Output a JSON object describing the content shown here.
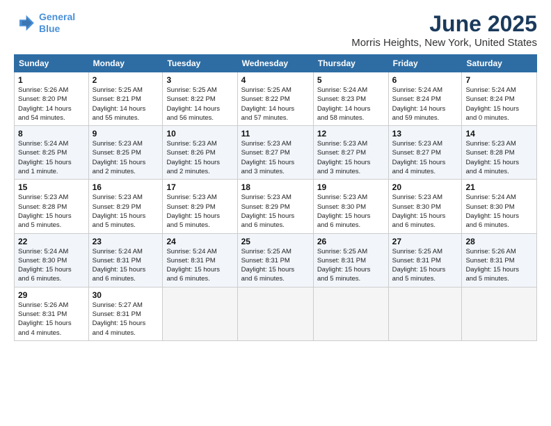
{
  "header": {
    "logo_line1": "General",
    "logo_line2": "Blue",
    "month": "June 2025",
    "location": "Morris Heights, New York, United States"
  },
  "weekdays": [
    "Sunday",
    "Monday",
    "Tuesday",
    "Wednesday",
    "Thursday",
    "Friday",
    "Saturday"
  ],
  "weeks": [
    [
      {
        "day": "1",
        "info": "Sunrise: 5:26 AM\nSunset: 8:20 PM\nDaylight: 14 hours\nand 54 minutes."
      },
      {
        "day": "2",
        "info": "Sunrise: 5:25 AM\nSunset: 8:21 PM\nDaylight: 14 hours\nand 55 minutes."
      },
      {
        "day": "3",
        "info": "Sunrise: 5:25 AM\nSunset: 8:22 PM\nDaylight: 14 hours\nand 56 minutes."
      },
      {
        "day": "4",
        "info": "Sunrise: 5:25 AM\nSunset: 8:22 PM\nDaylight: 14 hours\nand 57 minutes."
      },
      {
        "day": "5",
        "info": "Sunrise: 5:24 AM\nSunset: 8:23 PM\nDaylight: 14 hours\nand 58 minutes."
      },
      {
        "day": "6",
        "info": "Sunrise: 5:24 AM\nSunset: 8:24 PM\nDaylight: 14 hours\nand 59 minutes."
      },
      {
        "day": "7",
        "info": "Sunrise: 5:24 AM\nSunset: 8:24 PM\nDaylight: 15 hours\nand 0 minutes."
      }
    ],
    [
      {
        "day": "8",
        "info": "Sunrise: 5:24 AM\nSunset: 8:25 PM\nDaylight: 15 hours\nand 1 minute."
      },
      {
        "day": "9",
        "info": "Sunrise: 5:23 AM\nSunset: 8:25 PM\nDaylight: 15 hours\nand 2 minutes."
      },
      {
        "day": "10",
        "info": "Sunrise: 5:23 AM\nSunset: 8:26 PM\nDaylight: 15 hours\nand 2 minutes."
      },
      {
        "day": "11",
        "info": "Sunrise: 5:23 AM\nSunset: 8:27 PM\nDaylight: 15 hours\nand 3 minutes."
      },
      {
        "day": "12",
        "info": "Sunrise: 5:23 AM\nSunset: 8:27 PM\nDaylight: 15 hours\nand 3 minutes."
      },
      {
        "day": "13",
        "info": "Sunrise: 5:23 AM\nSunset: 8:27 PM\nDaylight: 15 hours\nand 4 minutes."
      },
      {
        "day": "14",
        "info": "Sunrise: 5:23 AM\nSunset: 8:28 PM\nDaylight: 15 hours\nand 4 minutes."
      }
    ],
    [
      {
        "day": "15",
        "info": "Sunrise: 5:23 AM\nSunset: 8:28 PM\nDaylight: 15 hours\nand 5 minutes."
      },
      {
        "day": "16",
        "info": "Sunrise: 5:23 AM\nSunset: 8:29 PM\nDaylight: 15 hours\nand 5 minutes."
      },
      {
        "day": "17",
        "info": "Sunrise: 5:23 AM\nSunset: 8:29 PM\nDaylight: 15 hours\nand 5 minutes."
      },
      {
        "day": "18",
        "info": "Sunrise: 5:23 AM\nSunset: 8:29 PM\nDaylight: 15 hours\nand 6 minutes."
      },
      {
        "day": "19",
        "info": "Sunrise: 5:23 AM\nSunset: 8:30 PM\nDaylight: 15 hours\nand 6 minutes."
      },
      {
        "day": "20",
        "info": "Sunrise: 5:23 AM\nSunset: 8:30 PM\nDaylight: 15 hours\nand 6 minutes."
      },
      {
        "day": "21",
        "info": "Sunrise: 5:24 AM\nSunset: 8:30 PM\nDaylight: 15 hours\nand 6 minutes."
      }
    ],
    [
      {
        "day": "22",
        "info": "Sunrise: 5:24 AM\nSunset: 8:30 PM\nDaylight: 15 hours\nand 6 minutes."
      },
      {
        "day": "23",
        "info": "Sunrise: 5:24 AM\nSunset: 8:31 PM\nDaylight: 15 hours\nand 6 minutes."
      },
      {
        "day": "24",
        "info": "Sunrise: 5:24 AM\nSunset: 8:31 PM\nDaylight: 15 hours\nand 6 minutes."
      },
      {
        "day": "25",
        "info": "Sunrise: 5:25 AM\nSunset: 8:31 PM\nDaylight: 15 hours\nand 6 minutes."
      },
      {
        "day": "26",
        "info": "Sunrise: 5:25 AM\nSunset: 8:31 PM\nDaylight: 15 hours\nand 5 minutes."
      },
      {
        "day": "27",
        "info": "Sunrise: 5:25 AM\nSunset: 8:31 PM\nDaylight: 15 hours\nand 5 minutes."
      },
      {
        "day": "28",
        "info": "Sunrise: 5:26 AM\nSunset: 8:31 PM\nDaylight: 15 hours\nand 5 minutes."
      }
    ],
    [
      {
        "day": "29",
        "info": "Sunrise: 5:26 AM\nSunset: 8:31 PM\nDaylight: 15 hours\nand 4 minutes."
      },
      {
        "day": "30",
        "info": "Sunrise: 5:27 AM\nSunset: 8:31 PM\nDaylight: 15 hours\nand 4 minutes."
      },
      null,
      null,
      null,
      null,
      null
    ]
  ]
}
